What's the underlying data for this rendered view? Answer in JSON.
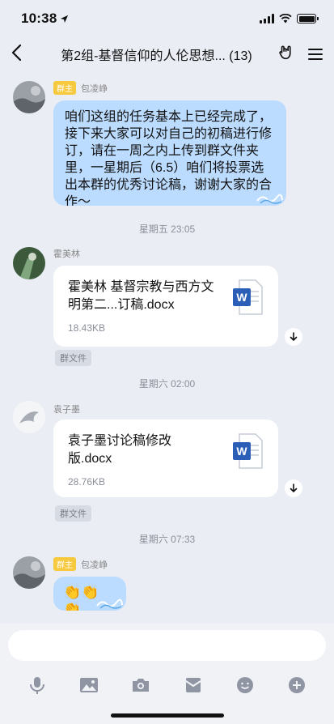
{
  "status": {
    "time": "10:38"
  },
  "header": {
    "title": "第2组-基督信仰的人伦思想... (13)"
  },
  "messages": [
    {
      "role": "群主",
      "sender": "包凌峥",
      "text": "咱们这组的任务基本上已经完成了，接下来大家可以对自己的初稿进行修订，请在一周之内上传到群文件夹里，一星期后（6.5）咱们将投票选出本群的优秀讨论稿，谢谢大家的合作～"
    },
    {
      "time": "星期五 23:05"
    },
    {
      "sender": "霍美林",
      "file_name": "霍美林 基督宗教与西方文明第二...订稿.docx",
      "file_size": "18.43KB",
      "tag": "群文件"
    },
    {
      "time": "星期六 02:00"
    },
    {
      "sender": "袁子墨",
      "file_name": "袁子墨讨论稿修改版.docx",
      "file_size": "28.76KB",
      "tag": "群文件"
    },
    {
      "time": "星期六 07:33"
    },
    {
      "role": "群主",
      "sender": "包凌峥",
      "text": "👏👏👏"
    }
  ],
  "icons": {
    "back": "chevron-left-icon",
    "hand": "rock-hand-icon",
    "menu": "hamburger-icon",
    "toolbar": [
      "microphone-icon",
      "image-icon",
      "camera-icon",
      "red-packet-icon",
      "emoji-icon",
      "plus-icon"
    ]
  },
  "colors": {
    "background": "#ebedf5",
    "bubble": "#bcdcff",
    "badge": "#f7c93e",
    "word_blue": "#2b5fb7"
  }
}
